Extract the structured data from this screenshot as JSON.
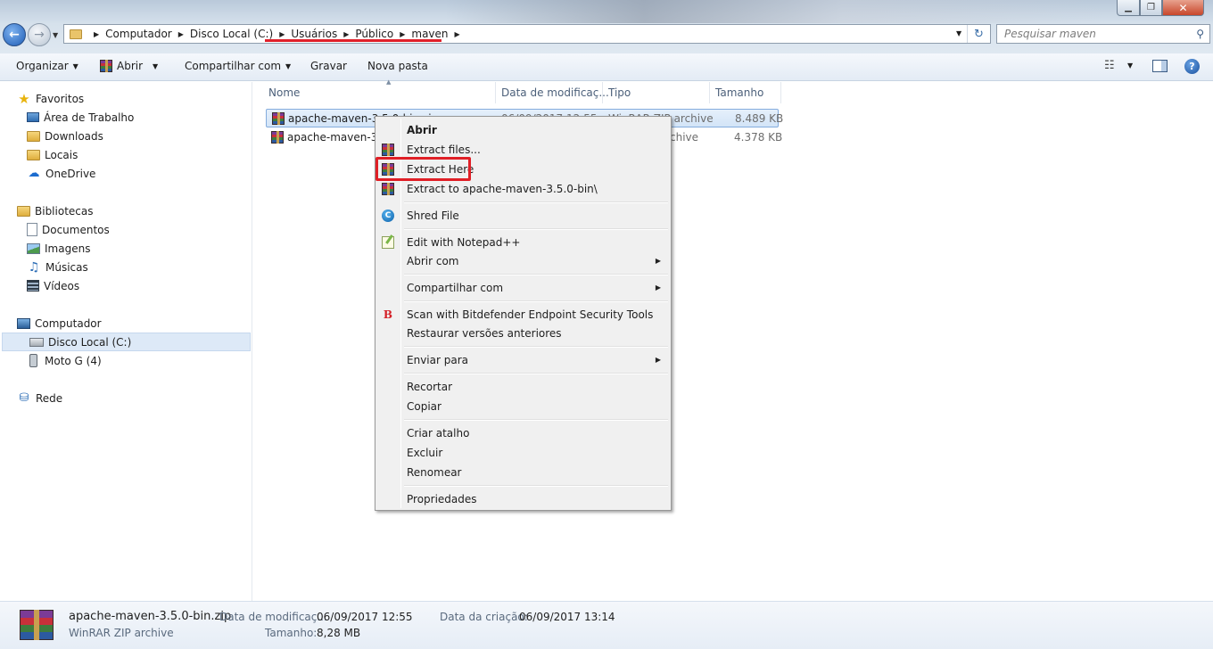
{
  "window": {
    "nav_back_glyph": "←",
    "nav_forward_glyph": "→",
    "breadcrumb": [
      "Computador",
      "Disco Local (C:)",
      "Usuários",
      "Público",
      "maven"
    ],
    "search_placeholder": "Pesquisar maven",
    "accent_red": "#e0202a"
  },
  "toolbar": {
    "organize": "Organizar",
    "open": "Abrir",
    "share": "Compartilhar com",
    "burn": "Gravar",
    "new_folder": "Nova pasta"
  },
  "nav": {
    "favorites": "Favoritos",
    "fav_items": [
      "Área de Trabalho",
      "Downloads",
      "Locais",
      "OneDrive"
    ],
    "libraries": "Bibliotecas",
    "lib_items": [
      "Documentos",
      "Imagens",
      "Músicas",
      "Vídeos"
    ],
    "computer": "Computador",
    "comp_items": [
      "Disco Local (C:)",
      "Moto G (4)"
    ],
    "network": "Rede"
  },
  "columns": {
    "name": "Nome",
    "modified": "Data de modificaç...",
    "type": "Tipo",
    "size": "Tamanho"
  },
  "files": [
    {
      "name": "apache-maven-3.5.0-bin.zip",
      "modified": "06/09/2017 12:55",
      "type": "WinRAR ZIP archive",
      "size": "8.489 KB"
    },
    {
      "name": "apache-maven-3.5",
      "modified": "",
      "type": "archive",
      "size": "4.378 KB"
    }
  ],
  "context_menu": {
    "open": "Abrir",
    "extract_files": "Extract files...",
    "extract_here": "Extract Here",
    "extract_to": "Extract to apache-maven-3.5.0-bin\\",
    "shred": "Shred File",
    "edit_npp": "Edit with Notepad++",
    "open_with": "Abrir com",
    "share_with": "Compartilhar com",
    "scan_bd": "Scan with Bitdefender Endpoint Security Tools",
    "restore": "Restaurar versões anteriores",
    "send_to": "Enviar para",
    "cut": "Recortar",
    "copy": "Copiar",
    "create_shortcut": "Criar atalho",
    "delete": "Excluir",
    "rename": "Renomear",
    "properties": "Propriedades"
  },
  "details": {
    "file_name": "apache-maven-3.5.0-bin.zip",
    "file_type": "WinRAR ZIP archive",
    "modified_label": "Data de modificaç...",
    "modified_value": "06/09/2017 12:55",
    "created_label": "Data da criação:",
    "created_value": "06/09/2017 13:14",
    "size_label": "Tamanho:",
    "size_value": "8,28 MB"
  }
}
